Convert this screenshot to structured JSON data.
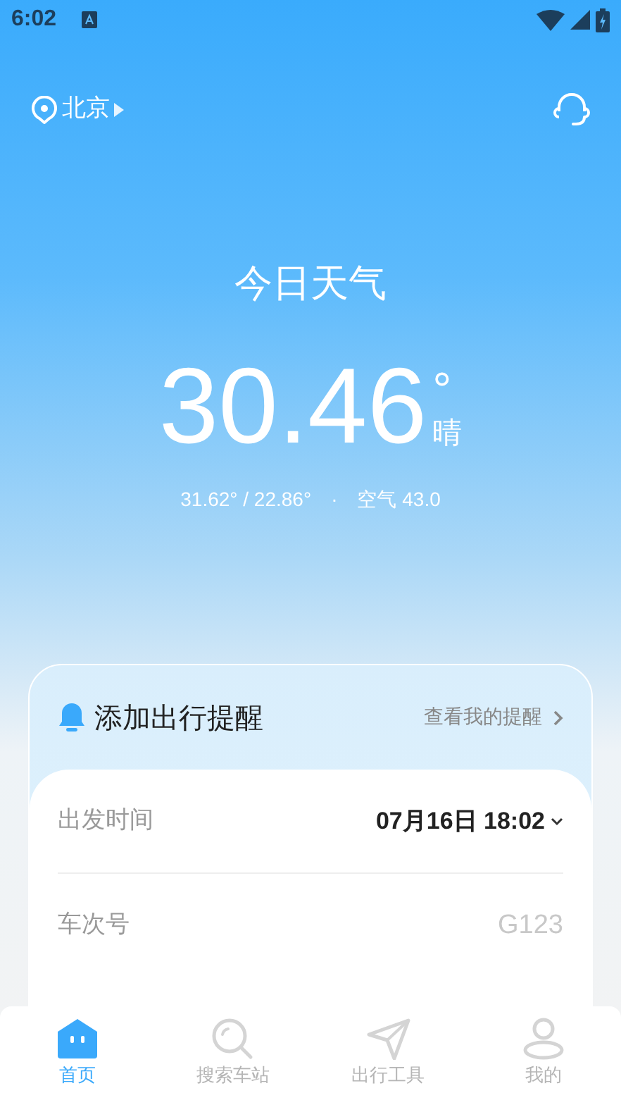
{
  "status_bar": {
    "time": "6:02"
  },
  "header": {
    "city": "北京"
  },
  "weather": {
    "title": "今日天气",
    "temperature": "30.46",
    "unit": "°",
    "condition": "晴",
    "range": "31.62° / 22.86°",
    "separator": "·",
    "air": "空气 43.0"
  },
  "reminder": {
    "title": "添加出行提醒",
    "link": "查看我的提醒",
    "fields": [
      {
        "label": "出发时间",
        "value": "07月16日 18:02",
        "kind": "select"
      },
      {
        "label": "车次号",
        "placeholder": "G123",
        "kind": "input"
      }
    ]
  },
  "tabs": [
    {
      "label": "首页",
      "kind": "home",
      "selected": true
    },
    {
      "label": "搜索车站",
      "kind": "search",
      "selected": false
    },
    {
      "label": "出行工具",
      "kind": "send",
      "selected": false
    },
    {
      "label": "我的",
      "kind": "user",
      "selected": false
    }
  ]
}
